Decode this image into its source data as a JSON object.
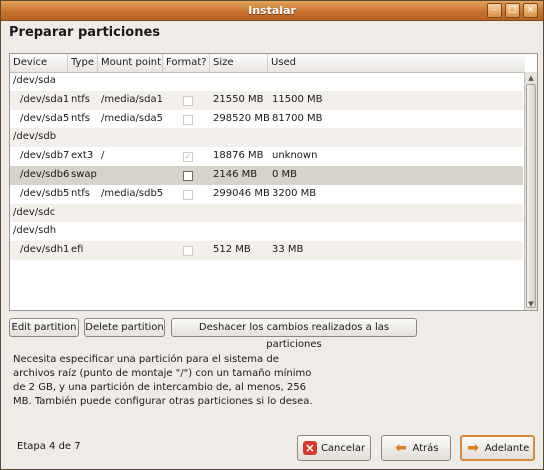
{
  "window": {
    "title": "Instalar"
  },
  "page": {
    "heading": "Preparar particiones"
  },
  "table": {
    "headers": [
      "Device",
      "Type",
      "Mount point",
      "Format?",
      "Size",
      "Used"
    ],
    "rows": [
      {
        "device": "/dev/sda",
        "type": "",
        "mount": "",
        "format": "",
        "size": "",
        "used": ""
      },
      {
        "device": "/dev/sda1",
        "type": "ntfs",
        "mount": "/media/sda1",
        "format": "unchecked",
        "size": "21550 MB",
        "used": "11500 MB"
      },
      {
        "device": "/dev/sda5",
        "type": "ntfs",
        "mount": "/media/sda5",
        "format": "unchecked",
        "size": "298520 MB",
        "used": "81700 MB"
      },
      {
        "device": "/dev/sdb",
        "type": "",
        "mount": "",
        "format": "",
        "size": "",
        "used": ""
      },
      {
        "device": "/dev/sdb7",
        "type": "ext3",
        "mount": "/",
        "format": "checked",
        "size": "18876 MB",
        "used": "unknown"
      },
      {
        "device": "/dev/sdb6",
        "type": "swap",
        "mount": "",
        "format": "unchecked",
        "size": "2146 MB",
        "used": "0 MB"
      },
      {
        "device": "/dev/sdb5",
        "type": "ntfs",
        "mount": "/media/sdb5",
        "format": "unchecked",
        "size": "299046 MB",
        "used": "3200 MB"
      },
      {
        "device": "/dev/sdc",
        "type": "",
        "mount": "",
        "format": "",
        "size": "",
        "used": ""
      },
      {
        "device": "/dev/sdh",
        "type": "",
        "mount": "",
        "format": "",
        "size": "",
        "used": ""
      },
      {
        "device": "/dev/sdh1",
        "type": "efi",
        "mount": "",
        "format": "unchecked",
        "size": "512 MB",
        "used": "33 MB"
      }
    ],
    "selected_device": "/dev/sdb6"
  },
  "actions": {
    "edit": "Edit partition",
    "delete": "Delete partition",
    "undo": "Deshacer los cambios realizados a las particiones"
  },
  "message": "Necesita especificar una partición para el sistema de archivos raíz (punto de montaje \"/\") con un tamaño mínimo de 2 GB, y una partición de intercambio de, al menos, 256 MB. También puede configurar otras particiones si lo desea.",
  "footer": {
    "step": "Etapa 4 de 7",
    "cancel": "Cancelar",
    "back": "Atrás",
    "forward": "Adelante"
  },
  "icons": {
    "cancel": "cancel-icon",
    "back": "back-arrow-icon",
    "forward": "forward-arrow-icon"
  },
  "colors": {
    "titlebar": "#c7732e",
    "selected_row": "#d8d3ca",
    "cancel_icon": "#d53a2c",
    "arrow": "#e07d1d"
  }
}
